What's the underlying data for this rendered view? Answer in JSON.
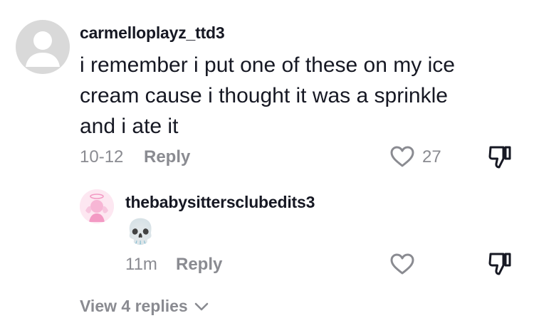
{
  "comment": {
    "username": "carmelloplayz_ttd3",
    "text": "i remember i put one of these on my ice cream cause i thought it was a sprinkle and i ate it",
    "date": "10-12",
    "reply_label": "Reply",
    "like_count": "27",
    "avatar_icon": "default-avatar-icon",
    "like_icon": "heart-outline-icon",
    "dislike_icon": "thumbs-down-icon"
  },
  "reply": {
    "username": "thebabysittersclubedits3",
    "text": "💀",
    "time": "11m",
    "reply_label": "Reply",
    "like_icon": "heart-outline-icon",
    "dislike_icon": "thumbs-down-icon"
  },
  "view_replies": {
    "label": "View 4 replies",
    "icon": "chevron-down-icon"
  },
  "colors": {
    "text": "#161823",
    "muted": "#8a8b91",
    "avatar_gray": "#d9d9d9",
    "reply_avatar_pink": "#fde7f1"
  }
}
